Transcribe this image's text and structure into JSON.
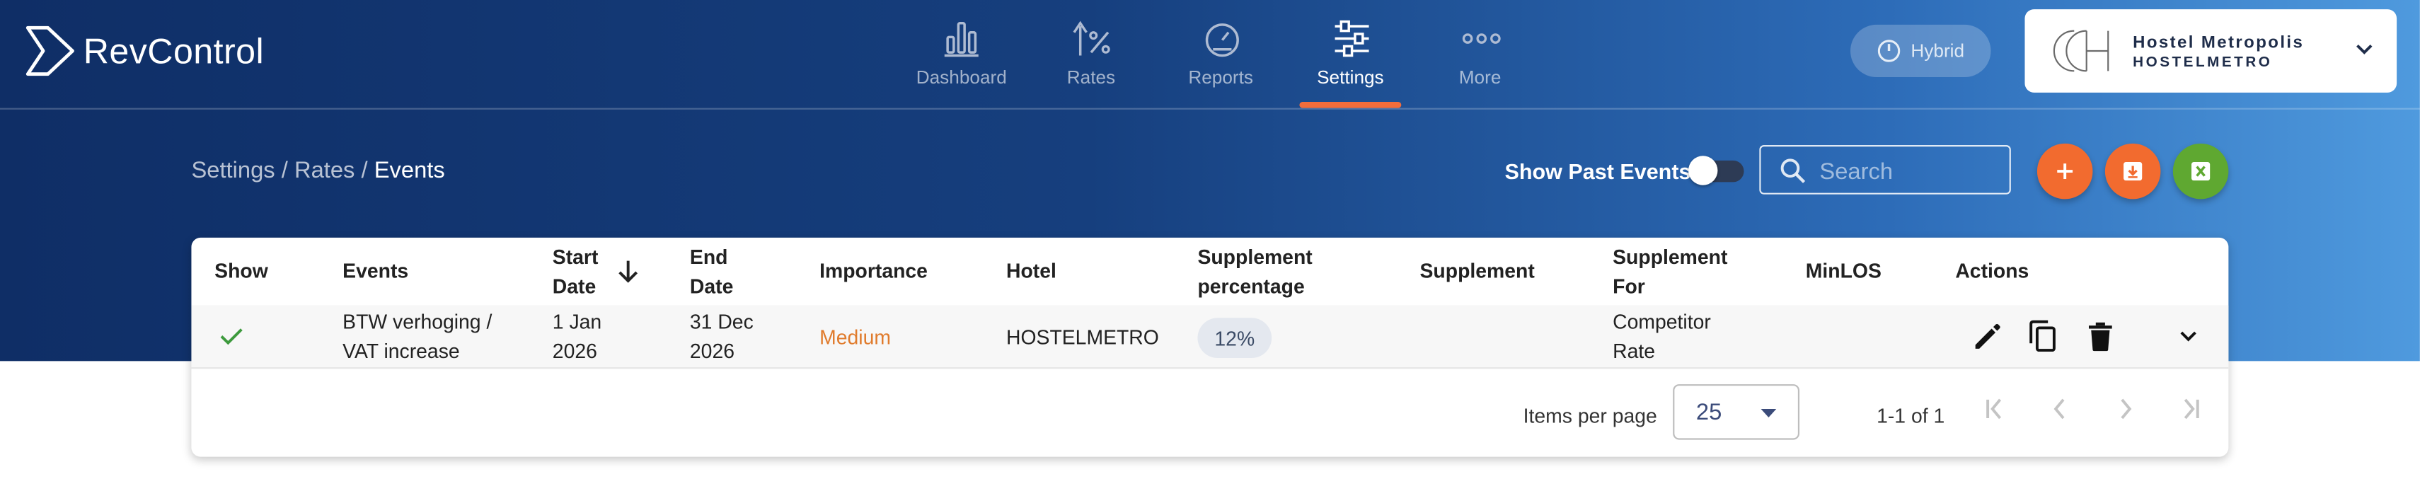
{
  "app": {
    "name": "RevControl"
  },
  "nav": [
    {
      "label": "Dashboard",
      "icon": "bar-chart-icon"
    },
    {
      "label": "Rates",
      "icon": "rate-percent-icon"
    },
    {
      "label": "Reports",
      "icon": "gauge-icon"
    },
    {
      "label": "Settings",
      "icon": "sliders-icon",
      "active": true
    },
    {
      "label": "More",
      "icon": "more-dots-icon"
    }
  ],
  "mode": {
    "label": "Hybrid"
  },
  "hotel": {
    "name": "Hostel Metropolis",
    "code": "HOSTELMETRO"
  },
  "breadcrumb": {
    "part1": "Settings",
    "sep": " / ",
    "part2": "Rates",
    "current": "Events"
  },
  "filters": {
    "show_past_label": "Show Past Events:",
    "show_past_on": false,
    "search_placeholder": "Search"
  },
  "table": {
    "columns": {
      "show": "Show",
      "events": "Events",
      "start_date": [
        "Start",
        "Date"
      ],
      "end_date": [
        "End",
        "Date"
      ],
      "importance": "Importance",
      "hotel": "Hotel",
      "supplement_pct": [
        "Supplement",
        "percentage"
      ],
      "supplement": "Supplement",
      "supplement_for": [
        "Supplement",
        "For"
      ],
      "minlos": "MinLOS",
      "actions": "Actions"
    },
    "rows": [
      {
        "show": true,
        "event": [
          "BTW verhoging /",
          "VAT increase"
        ],
        "start": [
          "1 Jan",
          "2026"
        ],
        "end": [
          "31 Dec",
          "2026"
        ],
        "importance": "Medium",
        "hotel": "HOSTELMETRO",
        "supplement_pct": "12%",
        "supplement": "",
        "supplement_for": [
          "Competitor",
          "Rate"
        ],
        "minlos": ""
      }
    ]
  },
  "pagination": {
    "items_per_page_label": "Items per page",
    "items_per_page": "25",
    "range": "1-1 of 1"
  },
  "colors": {
    "accent": "#f26b2f",
    "excel": "#5fa831",
    "importance_medium": "#e07b2c",
    "check": "#3d9a3d"
  }
}
